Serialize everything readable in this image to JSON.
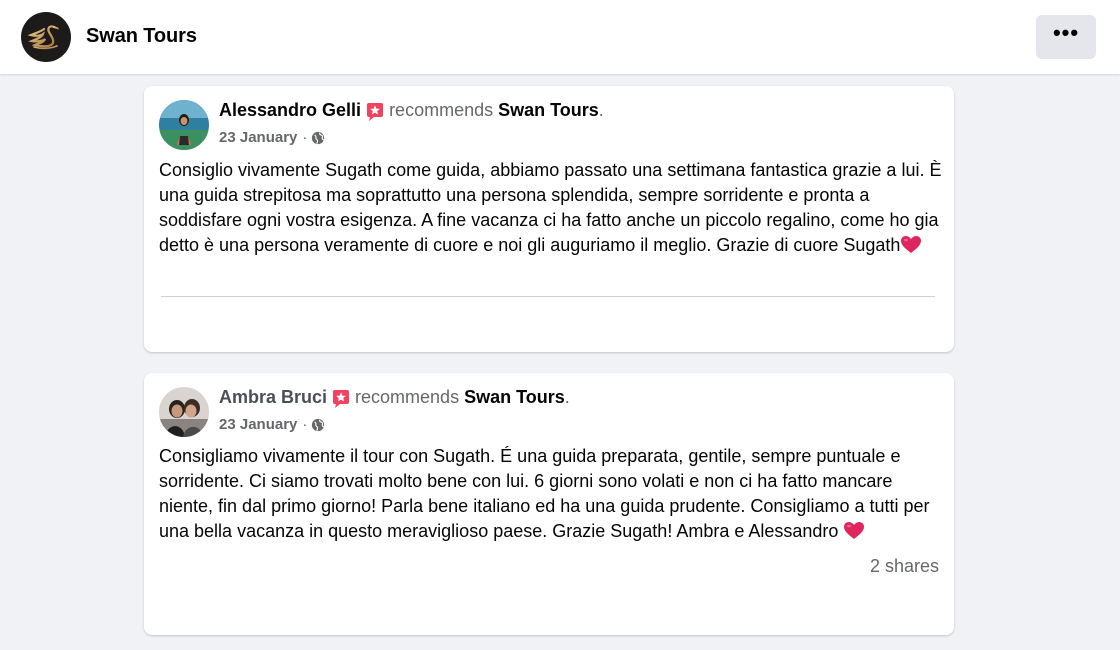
{
  "header": {
    "page_name": "Swan Tours",
    "more_button_label": "•••",
    "logo_icon": "swan-logo-icon"
  },
  "posts": [
    {
      "author": "Alessandro Gelli",
      "recommends_text": "recommends",
      "target": "Swan Tours",
      "period": ".",
      "date": "23 January",
      "separator": "·",
      "privacy_icon": "globe-icon",
      "text": "Consiglio vivamente Sugath come guida, abbiamo passato una settimana fantastica grazie a lui. È una guida strepitosa ma soprattutto una persona splendida, sempre sorridente e pronta a soddisfare ogni vostra esigenza. A fine vacanza ci ha fatto anche un piccolo regalino, come ho gia detto è una persona veramente di cuore e noi gli auguriamo il meglio. Grazie di cuore Sugath"
    },
    {
      "author": "Ambra Bruci",
      "recommends_text": "recommends",
      "target": "Swan Tours",
      "period": ".",
      "date": "23 January",
      "separator": "·",
      "privacy_icon": "globe-icon",
      "text": "Consigliamo vivamente il tour con Sugath. É una guida preparata, gentile, sempre puntuale e sorridente. Ci siamo trovati molto bene con lui. 6 giorni sono volati e non ci ha fatto mancare niente, fin dal primo giorno! Parla bene italiano ed ha una guida prudente. Consigliamo a tutti per una bella vacanza in questo meraviglioso paese. Grazie Sugath! Ambra e Alessandro ",
      "shares": "2 shares"
    }
  ],
  "colors": {
    "background": "#f0f2f5",
    "card": "#ffffff",
    "recommend_badge": "#f3425f",
    "heart": "#e0245e",
    "secondary_text": "#65676b"
  }
}
